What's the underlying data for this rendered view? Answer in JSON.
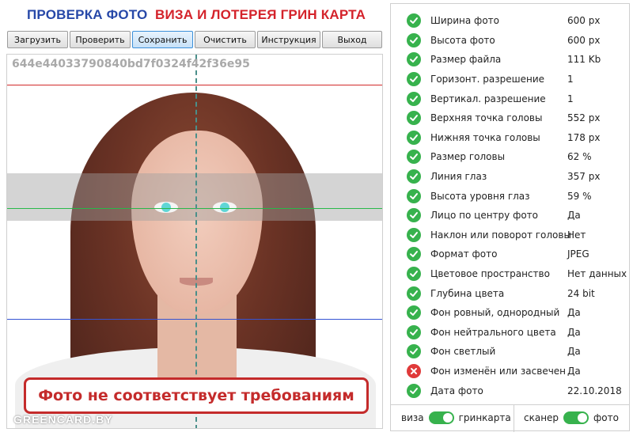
{
  "header": {
    "title_left": "ПРОВЕРКА ФОТО",
    "title_right": "ВИЗА И ЛОТЕРЕЯ ГРИН КАРТА"
  },
  "toolbar": {
    "load": "Загрузить",
    "check": "Проверить",
    "save": "Сохранить",
    "clear": "Очистить",
    "instructions": "Инструкция",
    "exit": "Выход"
  },
  "photo": {
    "hash": "644e44033790840bd7f0324f42f36e95",
    "status": "Фото не соответствует требованиям",
    "watermark": "GREENCARD.BY"
  },
  "checks": [
    {
      "label": "Ширина фото",
      "value": "600 px",
      "status": "ok"
    },
    {
      "label": "Высота фото",
      "value": "600 px",
      "status": "ok"
    },
    {
      "label": "Размер файла",
      "value": "111 Kb",
      "status": "ok"
    },
    {
      "label": "Горизонт. разрешение",
      "value": "1",
      "status": "ok"
    },
    {
      "label": "Вертикал. разрешение",
      "value": "1",
      "status": "ok"
    },
    {
      "label": "Верхняя точка головы",
      "value": "552 px",
      "status": "ok"
    },
    {
      "label": "Нижняя точка головы",
      "value": "178 px",
      "status": "ok"
    },
    {
      "label": "Размер головы",
      "value": "62 %",
      "status": "ok"
    },
    {
      "label": "Линия глаз",
      "value": "357 px",
      "status": "ok"
    },
    {
      "label": "Высота уровня глаз",
      "value": "59 %",
      "status": "ok"
    },
    {
      "label": "Лицо по центру фото",
      "value": "Да",
      "status": "ok"
    },
    {
      "label": "Наклон или поворот головы",
      "value": "Нет",
      "status": "ok"
    },
    {
      "label": "Формат фото",
      "value": "JPEG",
      "status": "ok"
    },
    {
      "label": "Цветовое пространство",
      "value": "Нет данных",
      "status": "ok"
    },
    {
      "label": "Глубина цвета",
      "value": "24 bit",
      "status": "ok"
    },
    {
      "label": "Фон ровный, однородный",
      "value": "Да",
      "status": "ok"
    },
    {
      "label": "Фон нейтрального цвета",
      "value": "Да",
      "status": "ok"
    },
    {
      "label": "Фон светлый",
      "value": "Да",
      "status": "ok"
    },
    {
      "label": "Фон изменён или засвечен",
      "value": "Да",
      "status": "error"
    },
    {
      "label": "Дата фото",
      "value": "22.10.2018",
      "status": "ok"
    }
  ],
  "toggles": {
    "mode_left": "виза",
    "mode_right": "гринкарта",
    "source_left": "сканер",
    "source_right": "фото"
  },
  "colors": {
    "ok": "#37b24d",
    "error": "#e03a3a",
    "title_blue": "#2748a8",
    "title_red": "#d4232b"
  }
}
